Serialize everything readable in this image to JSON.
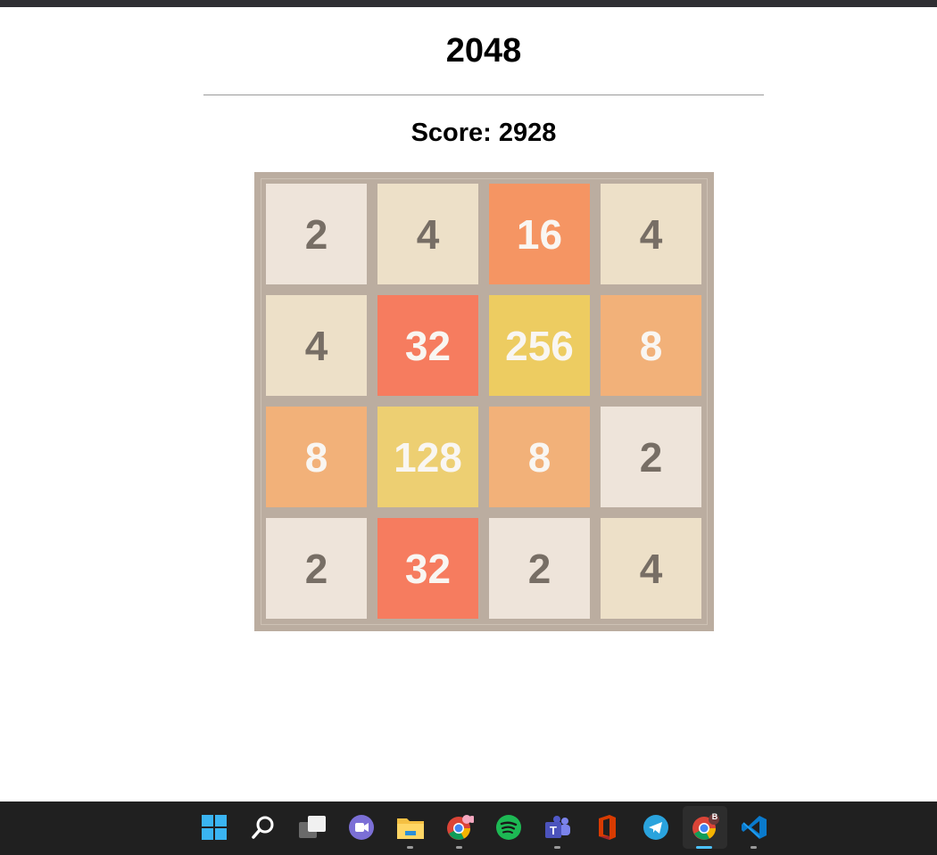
{
  "game": {
    "title": "2048",
    "score_text": "Score: 2928"
  },
  "board": {
    "rows": [
      [
        "2",
        "4",
        "16",
        "4"
      ],
      [
        "4",
        "32",
        "256",
        "8"
      ],
      [
        "8",
        "128",
        "8",
        "2"
      ],
      [
        "2",
        "32",
        "2",
        "4"
      ]
    ]
  },
  "tile_colors": {
    "2": {
      "bg": "#eee4da",
      "fg": "#776e65"
    },
    "4": {
      "bg": "#ede0c8",
      "fg": "#776e65"
    },
    "8": {
      "bg": "#f2b179",
      "fg": "#f9f6f2"
    },
    "16": {
      "bg": "#f59563",
      "fg": "#f9f6f2"
    },
    "32": {
      "bg": "#f67c5f",
      "fg": "#f9f6f2"
    },
    "128": {
      "bg": "#edcf72",
      "fg": "#f9f6f2"
    },
    "256": {
      "bg": "#edcc61",
      "fg": "#f9f6f2"
    }
  },
  "taskbar": {
    "items": [
      {
        "name": "start-icon"
      },
      {
        "name": "search-icon"
      },
      {
        "name": "task-view-icon"
      },
      {
        "name": "teams-chat-icon"
      },
      {
        "name": "file-explorer-icon"
      },
      {
        "name": "chrome-icon"
      },
      {
        "name": "spotify-icon"
      },
      {
        "name": "teams-icon"
      },
      {
        "name": "office-icon"
      },
      {
        "name": "telegram-icon"
      },
      {
        "name": "chrome-profile-icon",
        "badge": "B"
      },
      {
        "name": "vscode-icon"
      }
    ]
  },
  "colors": {
    "board_bg": "#bbada0",
    "taskbar_bg": "#202020",
    "accent": "#4cc2ff"
  }
}
